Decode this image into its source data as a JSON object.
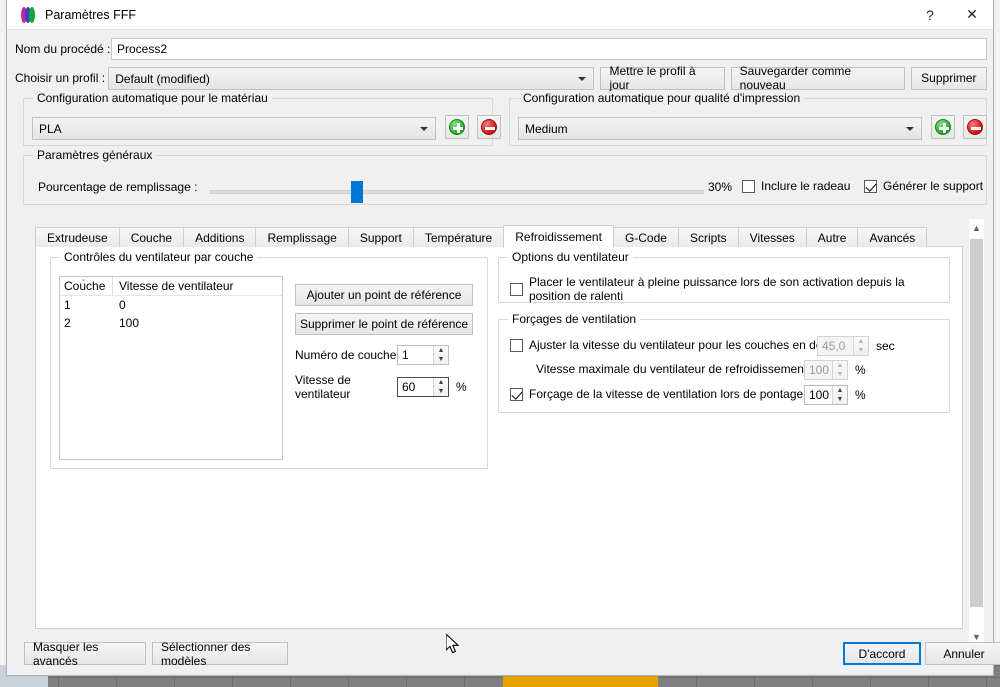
{
  "window": {
    "title": "Paramètres FFF",
    "icon": "s3d-logo-icon",
    "help_label": "?",
    "close_label": "✕"
  },
  "process": {
    "name_label": "Nom du procédé :",
    "name_value": "Process2",
    "name_placeholder": "Nom du procédé"
  },
  "profile": {
    "label": "Choisir un profil :",
    "value": "Default (modified)",
    "update_button": "Mettre le profil à jour",
    "save_as_new_button": "Sauvegarder comme nouveau",
    "delete_button": "Supprimer"
  },
  "material": {
    "group_title": "Configuration automatique pour le matériau",
    "value": "PLA",
    "add_label": "+",
    "remove_label": "−"
  },
  "quality": {
    "group_title": "Configuration automatique pour qualité d'impression",
    "value": "Medium",
    "add_label": "+",
    "remove_label": "−"
  },
  "general": {
    "group_title": "Paramètres généraux",
    "infill_label": "Pourcentage de remplissage :",
    "infill_value": "30%",
    "infill_percent": 30,
    "raft_label": "Inclure le radeau",
    "raft_checked": false,
    "support_label": "Générer le support",
    "support_checked": true
  },
  "tabs": [
    {
      "label": "Extrudeuse",
      "active": false
    },
    {
      "label": "Couche",
      "active": false
    },
    {
      "label": "Additions",
      "active": false
    },
    {
      "label": "Remplissage",
      "active": false
    },
    {
      "label": "Support",
      "active": false
    },
    {
      "label": "Température",
      "active": false
    },
    {
      "label": "Refroidissement",
      "active": true
    },
    {
      "label": "G-Code",
      "active": false
    },
    {
      "label": "Scripts",
      "active": false
    },
    {
      "label": "Vitesses",
      "active": false
    },
    {
      "label": "Autre",
      "active": false
    },
    {
      "label": "Avancés",
      "active": false
    }
  ],
  "fan_layer": {
    "group_title": "Contrôles du ventilateur par couche",
    "columns": [
      "Couche",
      "Vitesse de ventilateur"
    ],
    "rows": [
      {
        "layer": "1",
        "speed": "0"
      },
      {
        "layer": "2",
        "speed": "100"
      }
    ],
    "add_setpoint_button": "Ajouter un point de référence",
    "remove_setpoint_button": "Supprimer le point de référence",
    "layer_number_label": "Numéro de couche",
    "layer_number_value": "1",
    "fan_speed_label": "Vitesse de ventilateur",
    "fan_speed_value": "60",
    "fan_speed_unit": "%"
  },
  "fan_options": {
    "group_title": "Options du ventilateur",
    "blip_label": "Placer le ventilateur à pleine puissance lors de son activation depuis la position de ralenti",
    "blip_checked": false
  },
  "fan_overrides": {
    "group_title": "Forçages de ventilation",
    "adjust_label": "Ajuster la vitesse du ventilateur pour les couches en dessous",
    "adjust_checked": false,
    "adjust_value": "45,0",
    "adjust_unit": "sec",
    "max_speed_label": "Vitesse maximale du ventilateur de refroidissement",
    "max_speed_value": "100",
    "max_speed_unit": "%",
    "bridging_label": "Forçage de la vitesse de ventilation lors de pontage",
    "bridging_checked": true,
    "bridging_value": "100",
    "bridging_unit": "%"
  },
  "footer": {
    "hide_advanced_button": "Masquer les avancés",
    "select_models_button": "Sélectionner des modèles",
    "ok_button": "D'accord",
    "cancel_button": "Annuler"
  },
  "colors": {
    "accent": "#0078d7",
    "add": "#1faa1f",
    "remove": "#cc1111",
    "model": "#e8a200"
  }
}
